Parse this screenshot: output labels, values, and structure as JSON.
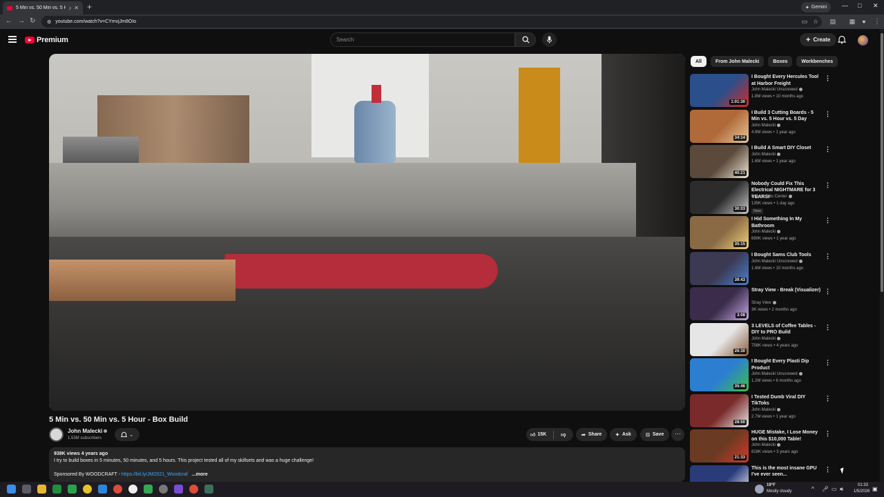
{
  "browser": {
    "tab_title": "5 Min vs. 50 Min vs. 5 Hour",
    "url": "youtube.com/watch?v=CYmvjJm8OIo",
    "gemini_label": "Gemini"
  },
  "header": {
    "logo_text": "Premium",
    "search_placeholder": "Search",
    "create_label": "Create"
  },
  "video": {
    "title": "5 Min vs. 50 Min vs. 5 Hour - Box Build",
    "channel": "John Malecki",
    "subscribers": "1.53M subscribers",
    "likes": "15K",
    "share_label": "Share",
    "ask_label": "Ask",
    "save_label": "Save",
    "views_age": "938K views  4 years ago",
    "description": "I try to build boxes in 5 minutes, 50 minutes, and 5 hours. This project tested all of my skillsets and was a huge challenge!",
    "sponsor_prefix": "Sponsored By WOODCRAFT - ",
    "sponsor_link": "https://bit.ly/JM2021_Woodcraf",
    "more_label": "...more"
  },
  "chips": [
    "All",
    "From John Malecki",
    "Boxes",
    "Workbenches"
  ],
  "recommendations": [
    {
      "title": "I Bought Every Hercules Tool at Harbor Freight",
      "channel": "John Malecki Unscrewed",
      "meta": "1.8M views • 10 months ago",
      "duration": "1:01:30",
      "thumb_color": "#2a4f8a",
      "thumb_accent": "#d22b2b"
    },
    {
      "title": "I Build 3 Cutting Boards - 5 Min vs. 5 Hour vs. 5 Day",
      "channel": "John Malecki",
      "meta": "4.9M views • 1 year ago",
      "duration": "34:14",
      "thumb_color": "#b06a3a",
      "thumb_accent": "#e8c79a"
    },
    {
      "title": "I Build A Smart DIY Closet",
      "channel": "John Malecki",
      "meta": "1.6M views • 1 year ago",
      "duration": "40:21",
      "thumb_color": "#5b4a3c",
      "thumb_accent": "#f0e5d2"
    },
    {
      "title": "Nobody Could Fix This Electrical NIGHTMARE for 3 YEARS!",
      "channel": "Dave's Auto Center",
      "meta": "135K views • 1 day ago",
      "badge": "New",
      "duration": "30:03",
      "thumb_color": "#2c2c2c",
      "thumb_accent": "#c7c7c7"
    },
    {
      "title": "I Hid Something In My Bathroom",
      "channel": "John Malecki",
      "meta": "690K views • 1 year ago",
      "duration": "35:15",
      "thumb_color": "#8a6a45",
      "thumb_accent": "#f3d27a"
    },
    {
      "title": "I Bought Sams Club Tools",
      "channel": "John Malecki Unscrewed",
      "meta": "1.6M views • 10 months ago",
      "duration": "39:43",
      "thumb_color": "#3b3a52",
      "thumb_accent": "#4d7fd1"
    },
    {
      "title": "Stray View - Break (Visualizer)",
      "channel": "Stray View",
      "meta": "3K views • 2 months ago",
      "duration": "3:08",
      "thumb_color": "#3a2c4a",
      "thumb_accent": "#c7a9e6"
    },
    {
      "title": "3 LEVELS of Coffee Tables -DIY to PRO Build",
      "channel": "John Malecki",
      "meta": "758K views • 4 years ago",
      "duration": "26:30",
      "thumb_color": "#e6e6e6",
      "thumb_accent": "#8a5a3a"
    },
    {
      "title": "I Bought Every Plasti Dip Product",
      "channel": "John Malecki Unscrewed",
      "meta": "1.2M views • 6 months ago",
      "duration": "35:46",
      "thumb_color": "#2c7fd0",
      "thumb_accent": "#3fbf4a"
    },
    {
      "title": "I Tested Dumb Viral DIY TikToks",
      "channel": "John Malecki",
      "meta": "2.7M views • 1 year ago",
      "duration": "28:50",
      "thumb_color": "#7a2a2a",
      "thumb_accent": "#e9e9e9"
    },
    {
      "title": "HUGE Mistake, I Lose Money on this $10,000 Table!",
      "channel": "John Malecki",
      "meta": "818K views • 3 years ago",
      "duration": "21:33",
      "thumb_color": "#6b3a22",
      "thumb_accent": "#d23a2a"
    },
    {
      "title": "This is the most insane GPU I've ever seen...",
      "channel": "",
      "meta": "",
      "duration": "",
      "thumb_color": "#2a3b7a",
      "thumb_accent": "#ffffff"
    }
  ],
  "taskbar": {
    "weather_temp": "19°F",
    "weather_desc": "Mostly cloudy",
    "time": "01:33",
    "date": "1/5/2026"
  },
  "colors": {
    "background": "#0f0f0f",
    "surface": "#272727",
    "brand_red": "#ff0033",
    "link": "#3ea6ff"
  }
}
